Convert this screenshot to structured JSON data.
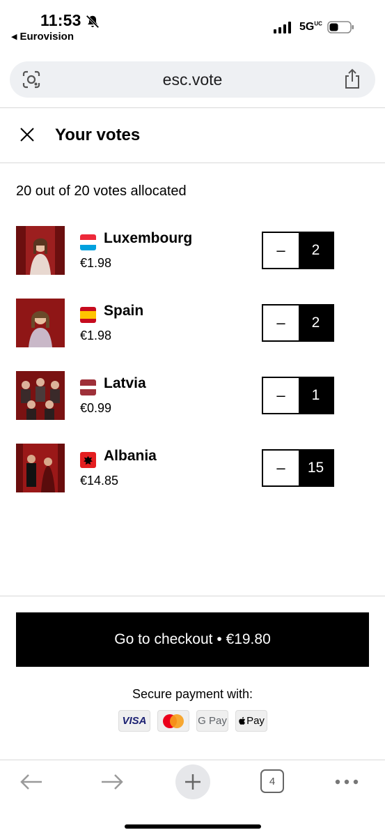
{
  "status_bar": {
    "time": "11:53",
    "back_app": "Eurovision",
    "network": "5G",
    "network_sup": "UC"
  },
  "browser": {
    "url": "esc.vote",
    "tab_count": "4"
  },
  "header": {
    "title": "Your votes"
  },
  "allocation": "20 out of 20 votes allocated",
  "votes": [
    {
      "country": "Luxembourg",
      "price": "€1.98",
      "count": "2",
      "minus_label": "–"
    },
    {
      "country": "Spain",
      "price": "€1.98",
      "count": "2",
      "minus_label": "–"
    },
    {
      "country": "Latvia",
      "price": "€0.99",
      "count": "1",
      "minus_label": "–"
    },
    {
      "country": "Albania",
      "price": "€14.85",
      "count": "15",
      "minus_label": "–"
    }
  ],
  "checkout": {
    "label": "Go to checkout • €19.80"
  },
  "payment": {
    "secure_label": "Secure payment with:",
    "methods": [
      "VISA",
      "G Pay",
      "Pay"
    ]
  },
  "colors": {
    "primary": "#000000",
    "address_bar": "#eef0f3",
    "toolbar_icon": "#8e8e93"
  }
}
